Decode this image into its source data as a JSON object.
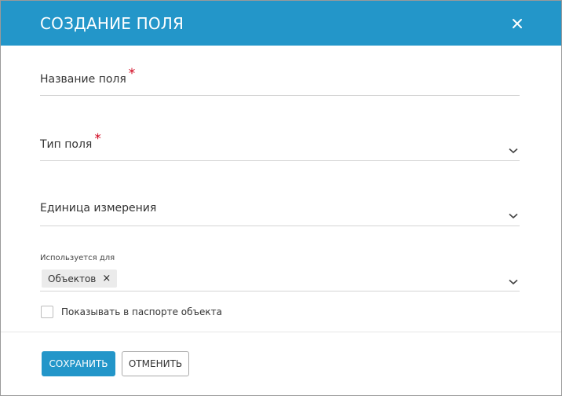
{
  "dialog": {
    "title": "СОЗДАНИЕ ПОЛЯ",
    "close_icon": "close-icon"
  },
  "fields": {
    "name": {
      "label": "Название поля",
      "required_mark": "*",
      "value": ""
    },
    "type": {
      "label": "Тип поля",
      "required_mark": "*",
      "value": "",
      "icon": "chevron-down-icon"
    },
    "unit": {
      "label": "Единица измерения",
      "value": "",
      "icon": "chevron-down-icon"
    },
    "used_for": {
      "label": "Используется для",
      "chips": [
        {
          "label": "Объектов",
          "remove_glyph": "×"
        }
      ],
      "icon": "chevron-down-icon"
    }
  },
  "checkbox": {
    "label": "Показывать в паспорте объекта",
    "checked": false
  },
  "buttons": {
    "save": "СОХРАНИТЬ",
    "cancel": "ОТМЕНИТЬ"
  },
  "colors": {
    "header": "#2396c9",
    "primary": "#2396c9",
    "required": "#d0021b"
  }
}
